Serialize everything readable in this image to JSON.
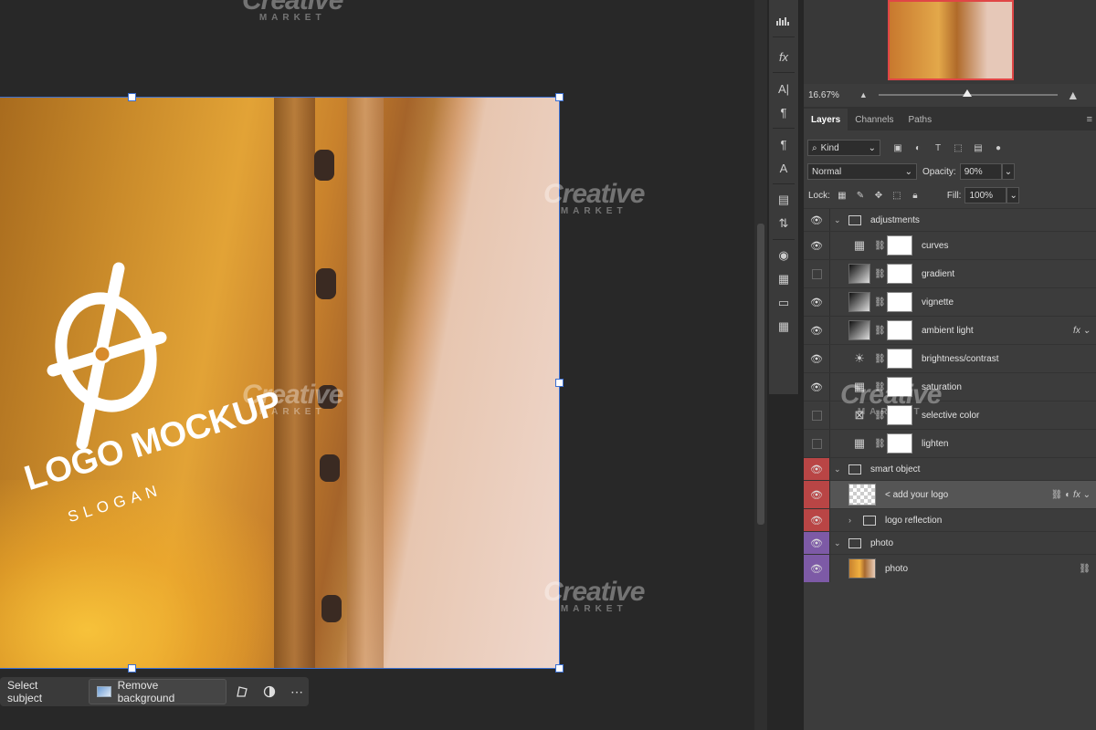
{
  "canvas": {
    "logo_title": "LOGO MOCKUP",
    "logo_slogan": "SLOGAN"
  },
  "context_bar": {
    "select_subject": "Select subject",
    "remove_background": "Remove background",
    "more": "⋯"
  },
  "navigator": {
    "zoom": "16.67%"
  },
  "tabs": [
    "Layers",
    "Channels",
    "Paths"
  ],
  "filter": {
    "kind_label": "Kind"
  },
  "blend": {
    "mode": "Normal",
    "opacity_label": "Opacity:",
    "opacity_value": "90%"
  },
  "lock": {
    "label": "Lock:",
    "fill_label": "Fill:",
    "fill_value": "100%"
  },
  "layers": {
    "adjustments": "adjustments",
    "curves": "curves",
    "gradient": "gradient",
    "vignette": "vignette",
    "ambient_light": "ambient light",
    "brightness_contrast": "brightness/contrast",
    "saturation": "saturation",
    "selective_color": "selective color",
    "lighten": "lighten",
    "smart_object": "smart object",
    "add_your_logo": "< add your logo",
    "logo_reflection": "logo reflection",
    "photo_group": "photo",
    "photo": "photo",
    "fx": "fx"
  },
  "watermark": {
    "brand": "Creative",
    "sub": "MARKET"
  },
  "colors": {
    "selection": "#3b6fd1",
    "label_red": "#b94545",
    "label_violet": "#7d5aa6",
    "nav_frame": "#e04646"
  }
}
